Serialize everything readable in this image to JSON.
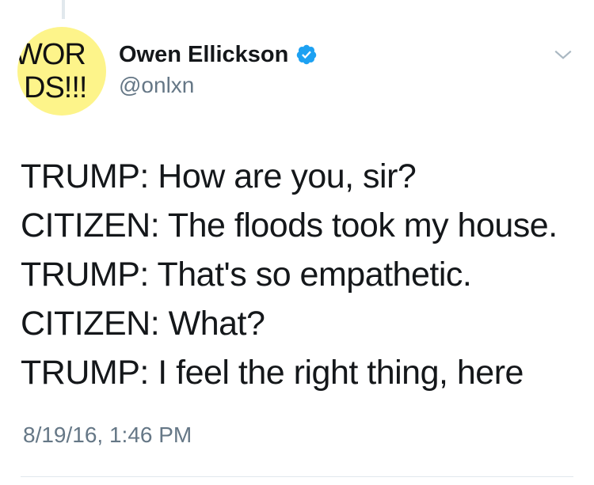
{
  "avatar": {
    "line1": "WOR",
    "line2": "DS!!!",
    "bg_color": "#fdf48a"
  },
  "user": {
    "display_name": "Owen Ellickson",
    "handle": "@onlxn",
    "verified_icon": "verified-badge-icon"
  },
  "menu": {
    "icon": "chevron-down-icon"
  },
  "tweet": {
    "lines": [
      "TRUMP: How are you, sir?",
      "CITIZEN: The floods took my house.",
      "TRUMP: That's so empathetic.",
      "CITIZEN: What?",
      "TRUMP: I feel the right thing, here"
    ],
    "timestamp": "8/19/16, 1:46 PM"
  },
  "colors": {
    "verified_blue": "#1da1f2",
    "secondary_text": "#657786",
    "primary_text": "#14171a"
  }
}
